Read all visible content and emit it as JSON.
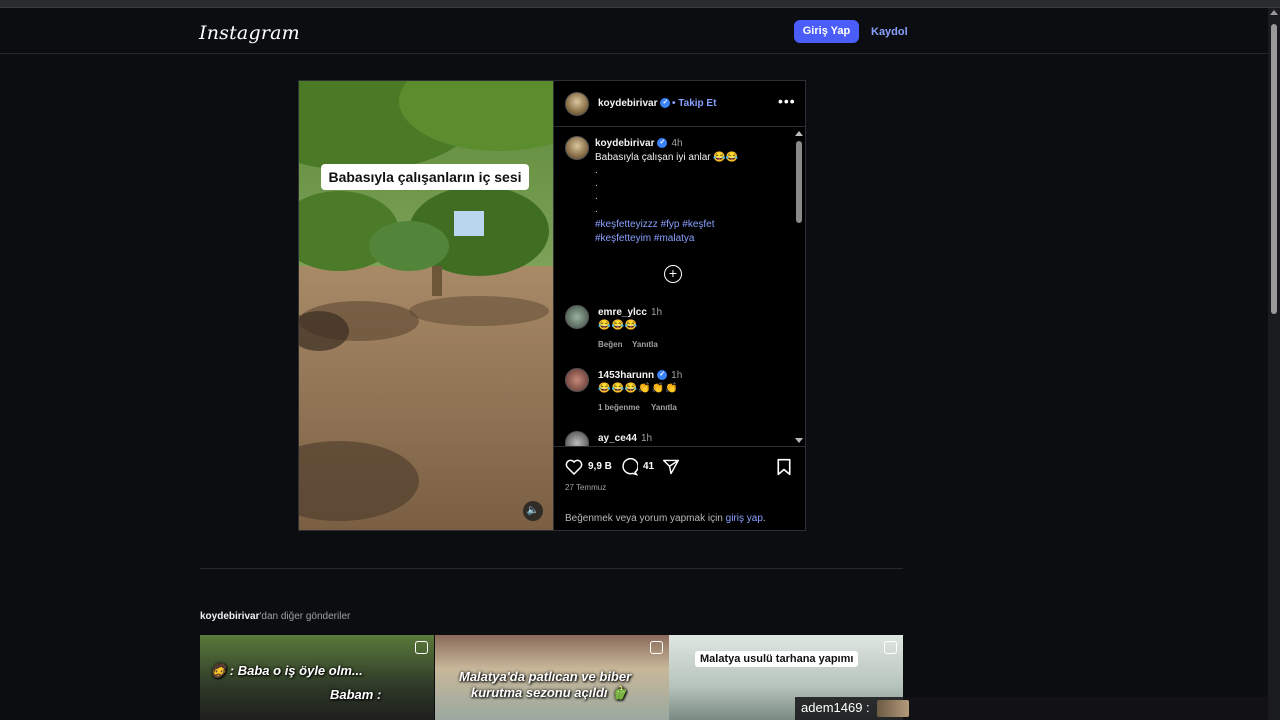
{
  "header": {
    "logo": "Instagram",
    "login_label": "Giriş Yap",
    "signup_label": "Kaydol"
  },
  "post": {
    "video_caption": "Babasıyla çalışanların iç sesi",
    "author": "koydebirivar",
    "follow_label": "• Takip Et",
    "caption_time": "4h",
    "caption_text": "Babasıyla çalışan iyi anlar 😂😂",
    "caption_dots": [
      ".",
      ".",
      ".",
      "."
    ],
    "hashtags_line1": "#keşfetteyizzz #fyp #keşfet",
    "hashtags_line2": "#keşfetteyim #malatya",
    "comments": [
      {
        "user": "emre_ylcc",
        "time": "1h",
        "text": "😂😂😂",
        "likes": "",
        "actions": [
          "Beğen",
          "Yanıtla"
        ]
      },
      {
        "user": "1453harunn",
        "time": "1h",
        "text": "😂😂😂👏👏👏",
        "likes": "1 beğenme",
        "actions": [
          "Yanıtla"
        ],
        "verified": true
      },
      {
        "user": "ay_ce44",
        "time": "1h",
        "text": ""
      }
    ],
    "like_count": "9,9 B",
    "comment_count": "41",
    "date": "27 Temmuz",
    "login_prompt": "Beğenmek veya yorum yapmak için",
    "login_link": "giriş yap",
    "login_suffix": "."
  },
  "more_posts": {
    "username": "koydebirivar",
    "suffix": "'dan diğer gönderiler",
    "items": [
      {
        "line1": "🧔 : Baba o iş öyle olm...",
        "line2": "Babam :"
      },
      {
        "line1": "Malatya'da patlıcan ve biber",
        "line2": "kurutma sezonu açıldı 🫑"
      },
      {
        "line1": "Malatya usulü tarhana yapımı",
        "line2": ""
      }
    ]
  },
  "overlay": {
    "chat_user": "adem1469 :"
  },
  "colors": {
    "accent": "#4a5df9",
    "link": "#8aa0ff",
    "background": "#0b0d10",
    "verified": "#3b82f6"
  }
}
